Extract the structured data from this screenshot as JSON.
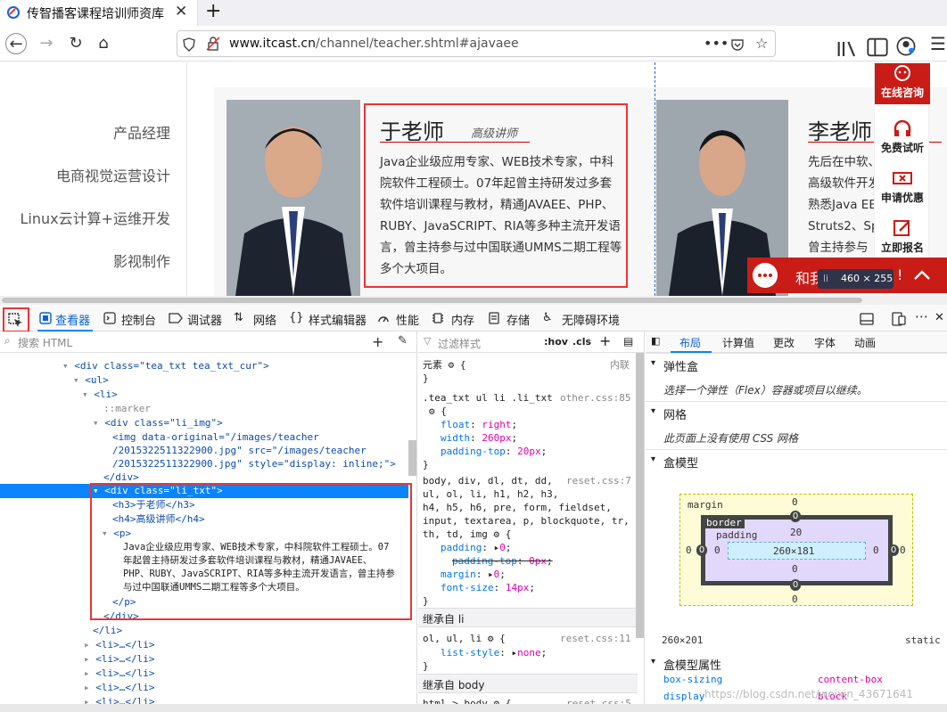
{
  "browser": {
    "tab_title": "传智播客课程培训师资库",
    "url_domain": "www.itcast.cn",
    "url_path": "/channel/teacher.shtml#ajavaee",
    "menu_dots": "•••"
  },
  "page": {
    "menu": [
      "产品经理",
      "电商视觉运营设计",
      "Linux云计算+运维开发",
      "影视制作"
    ],
    "teachers": [
      {
        "name": "于老师",
        "title": "高级讲师",
        "bio": "Java企业级应用专家、WEB技术专家，中科院软件工程硕士。07年起曾主持研发过多套软件培训课程与教材，精通JAVAEE、PHP、RUBY、JavaSCRIPT、RIA等多种主流开发语言，曾主持参与过中国联通UMMS二期工程等多个大项目。"
      },
      {
        "name": "李老师",
        "bio_lines": [
          "先后在中软、",
          "高级软件开发",
          "熟悉Java EE",
          "Struts2、Sp",
          "曾主持参与"
        ]
      }
    ],
    "side_buttons": [
      "在线咨询",
      "免费试听",
      "申请优惠",
      "立即报名"
    ],
    "chat_text": "和我",
    "chat_suffix": "!",
    "tooltip_tag": "li",
    "tooltip_size": "460 × 255"
  },
  "devtools": {
    "tabs": [
      "查看器",
      "控制台",
      "调试器",
      "网络",
      "样式编辑器",
      "性能",
      "内存",
      "存储",
      "无障碍环境"
    ],
    "search_placeholder": "搜索 HTML",
    "filter_placeholder": "过滤样式",
    "hov": ":hov",
    "cls": ".cls",
    "html_lines": {
      "l0": "<div class=\"tea_txt tea_txt_cur\">",
      "l1": "<ul>",
      "l2": "<li>",
      "l3": "::marker",
      "l4": "<div class=\"li_img\">",
      "l5a": "<img data-original=\"/images/teacher",
      "l5b": "/2015322511322900.jpg\" src=\"/images/teacher",
      "l5c": "/2015322511322900.jpg\" style=\"display: inline;\">",
      "l6": "</div>",
      "l7": "<div class=\"li_txt\">",
      "l8": "<h3>于老师</h3>",
      "l9": "<h4>高级讲师</h4>",
      "l10": "<p>",
      "l11a": "Java企业级应用专家、WEB技术专家，中科院软件工程硕士。07",
      "l11b": "年起曾主持研发过多套软件培训课程与教材，精通JAVAEE、",
      "l11c": "PHP、RUBY、JavaSCRIPT、RIA等多种主流开发语言，曾主持参",
      "l11d": "与过中国联通UMMS二期工程等多个大项目。",
      "l12": "</p>",
      "l13": "</div>",
      "l14": "</li>",
      "li_collapsed": "<li>…</li>"
    },
    "rules": {
      "element_label": "元素",
      "inline_label": "内联",
      "r1_selector": ".tea_txt ul li .li_txt",
      "r1_source": "other.css:85",
      "r1_props": [
        [
          "float",
          "right"
        ],
        [
          "width",
          "260px"
        ],
        [
          "padding-top",
          "20px"
        ]
      ],
      "r2_selector_a": "body, div, dl, dt, dd,",
      "r2_source": "reset.css:7",
      "r2_selector_b": "ul, ol, li, h1, h2, h3,",
      "r2_selector_c": "h4, h5, h6, pre, form, fieldset,",
      "r2_selector_d": "input, textarea, p, blockquote, tr,",
      "r2_selector_e": "th, td, img",
      "r2_props": [
        [
          "padding",
          "0"
        ],
        [
          "padding-top",
          "0px"
        ],
        [
          "margin",
          "0"
        ],
        [
          "font-size",
          "14px"
        ]
      ],
      "inherit1": "继承自 li",
      "r3_selector": "ol, ul, li",
      "r3_source": "reset.css:11",
      "r3_props": [
        [
          "list-style",
          "none"
        ]
      ],
      "inherit2": "继承自 body",
      "r4_selector": "html > body",
      "r4_source": "reset.css:5"
    },
    "layout": {
      "tabs": [
        "布局",
        "计算值",
        "更改",
        "字体",
        "动画"
      ],
      "flex_header": "弹性盒",
      "flex_hint": "选择一个弹性（Flex）容器或项目以继续。",
      "grid_header": "网格",
      "grid_hint": "此页面上没有使用 CSS 网格",
      "boxmodel_header": "盒模型",
      "margin_label": "margin",
      "border_label": "border",
      "padding_label": "padding",
      "margin_top": "0",
      "margin_right": "0",
      "margin_bottom": "0",
      "margin_left": "0",
      "border_top": "0",
      "border_right": "0",
      "border_bottom": "0",
      "border_left": "0",
      "padding_top": "20",
      "padding_right": "0",
      "padding_bottom": "0",
      "padding_left": "0",
      "content_size": "260×181",
      "total_size": "260×201",
      "position": "static",
      "props_header": "盒模型属性",
      "prop1_name": "box-sizing",
      "prop1_value": "content-box",
      "prop2_name": "display",
      "prop2_value": "block",
      "watermark": "https://blog.csdn.net/weixin_43671641"
    }
  }
}
